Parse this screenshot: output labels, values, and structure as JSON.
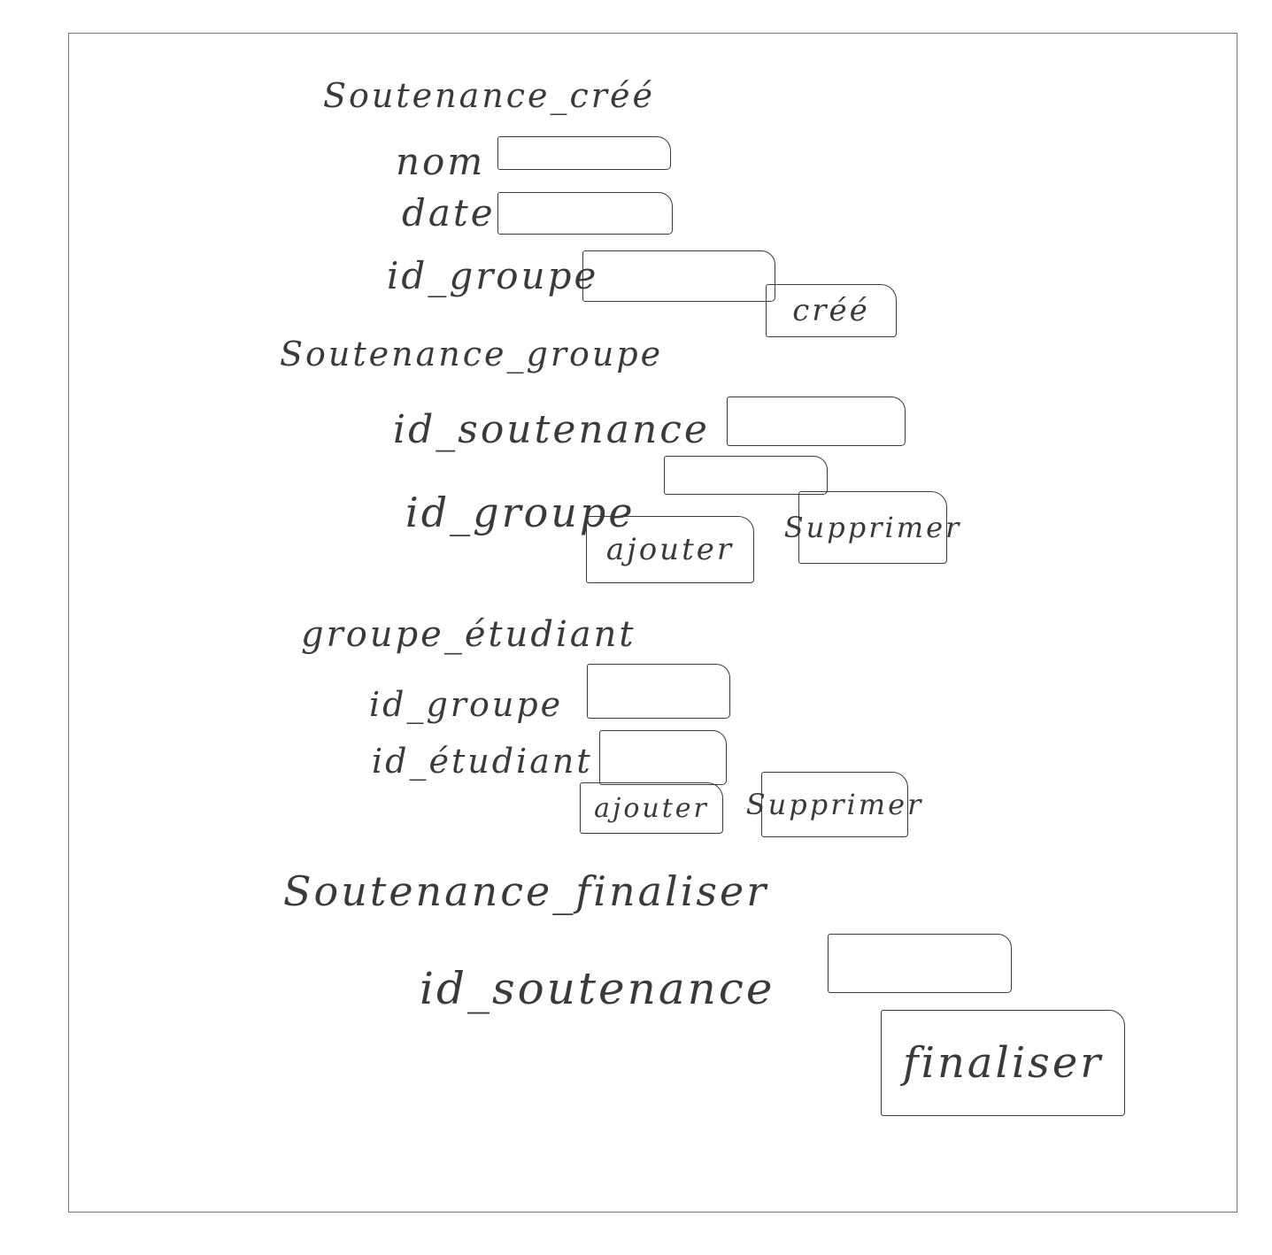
{
  "sections": {
    "create": {
      "title": "Soutenance_créé",
      "fields": {
        "nom_label": "nom",
        "date_label": "date",
        "id_groupe_label": "id_groupe"
      },
      "button_label": "créé"
    },
    "groupe": {
      "title": "Soutenance_groupe",
      "fields": {
        "id_soutenance_label": "id_soutenance",
        "id_groupe_label": "id_groupe"
      },
      "add_label": "ajouter",
      "delete_label": "Supprimer"
    },
    "etudiant": {
      "title": "groupe_étudiant",
      "fields": {
        "id_groupe_label": "id_groupe",
        "id_etudiant_label": "id_étudiant"
      },
      "add_label": "ajouter",
      "delete_label": "Supprimer"
    },
    "finaliser": {
      "title": "Soutenance_finaliser",
      "fields": {
        "id_soutenance_label": "id_soutenance"
      },
      "button_label": "finaliser"
    }
  }
}
